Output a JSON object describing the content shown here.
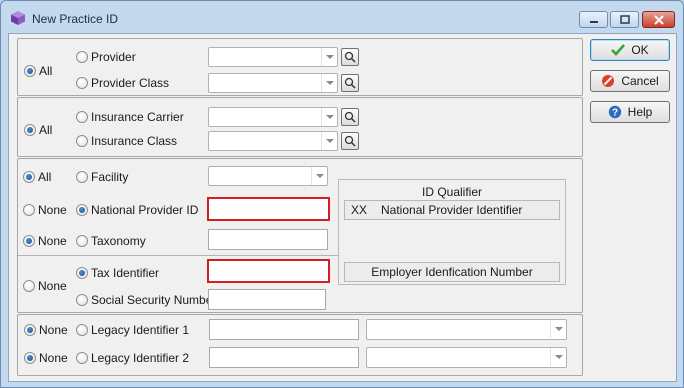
{
  "window": {
    "title": "New Practice ID",
    "icon": "cube-icon",
    "controls": [
      "minimize-icon",
      "maximize-icon",
      "close-icon"
    ]
  },
  "provider_group": {
    "all_label": "All",
    "options": [
      {
        "label": "Provider",
        "selected": false
      },
      {
        "label": "Provider Class",
        "selected": false
      }
    ],
    "scope_selected": "All"
  },
  "insurance_group": {
    "all_label": "All",
    "options": [
      {
        "label": "Insurance Carrier",
        "selected": false
      },
      {
        "label": "Insurance Class",
        "selected": false
      }
    ],
    "scope_selected": "All"
  },
  "facility_group": {
    "facility_row": {
      "scope_label": "All",
      "scope_selected": true,
      "option_label": "Facility"
    },
    "npi_row": {
      "scope_label": "None",
      "scope_selected": false,
      "option_label": "National Provider ID",
      "option_selected": true,
      "value": ""
    },
    "taxonomy_row": {
      "scope_label": "None",
      "scope_selected": true,
      "option_label": "Taxonomy",
      "value": ""
    }
  },
  "tax_group": {
    "scope_label": "None",
    "options": [
      {
        "label": "Tax Identifier",
        "selected": true
      },
      {
        "label": "Social Security Number",
        "selected": false
      }
    ]
  },
  "id_qualifier": {
    "title": "ID Qualifier",
    "rows": [
      {
        "code": "XX",
        "description": "National Provider Identifier"
      },
      {
        "code": "",
        "description": "Employer Idenfication Number"
      }
    ]
  },
  "legacy_group": {
    "rows": [
      {
        "scope_label": "None",
        "option_label": "Legacy Identifier 1"
      },
      {
        "scope_label": "None",
        "option_label": "Legacy Identifier 2"
      }
    ]
  },
  "buttons": {
    "ok": "OK",
    "cancel": "Cancel",
    "help": "Help"
  },
  "colors": {
    "validation_border": "#d11f1f",
    "title_bar": "#c4d9ee",
    "ok_check": "#3aa03a",
    "cancel_icon": "#d9402b",
    "help_icon": "#2d6bc2"
  }
}
